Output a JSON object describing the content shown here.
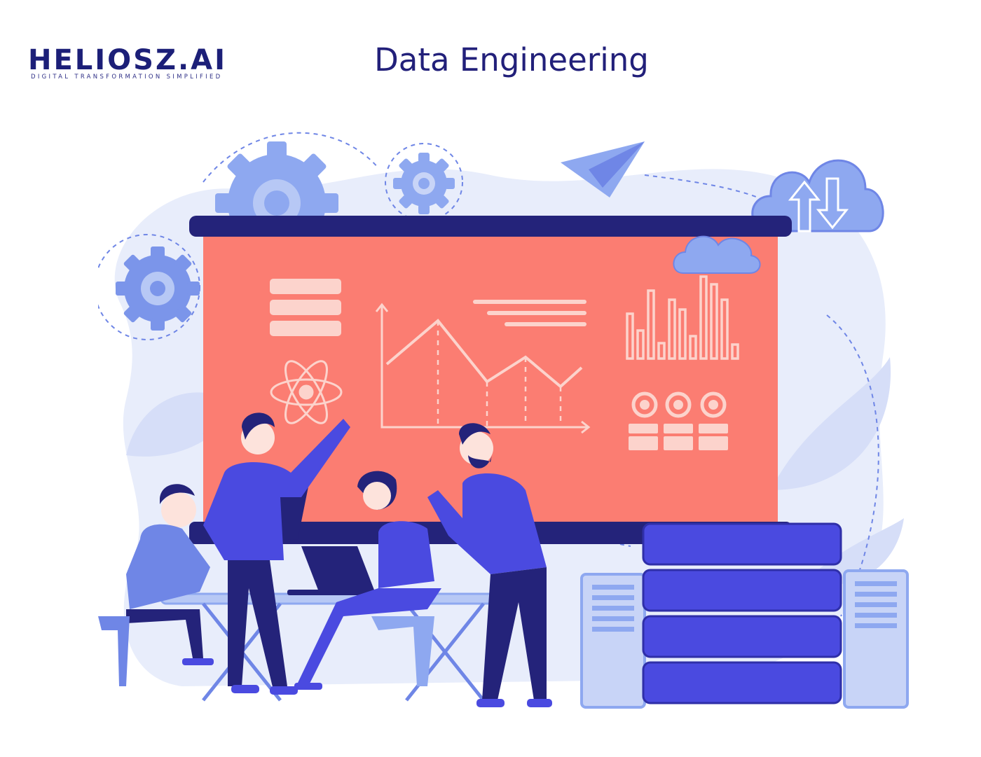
{
  "brand": {
    "name": "HELIOSZ.AI",
    "tagline": "DIGITAL TRANSFORMATION SIMPLIFIED"
  },
  "page": {
    "title": "Data Engineering"
  },
  "illustration": {
    "subject": "team-analyzing-data-dashboard",
    "icons": [
      "gear-icon",
      "paper-plane-icon",
      "cloud-upload-download-icon",
      "cloud-icon",
      "database-icon",
      "atom-icon",
      "server-icon",
      "laptop-icon",
      "tablet-icon"
    ]
  },
  "colors": {
    "brand_navy": "#1c1f78",
    "title": "#22207a",
    "screen": "#fb7d72",
    "accent_blue": "#4a4ae0",
    "light_blue": "#8ea8f0",
    "pale_blue": "#e8edfb",
    "dark_navy": "#24237a"
  }
}
